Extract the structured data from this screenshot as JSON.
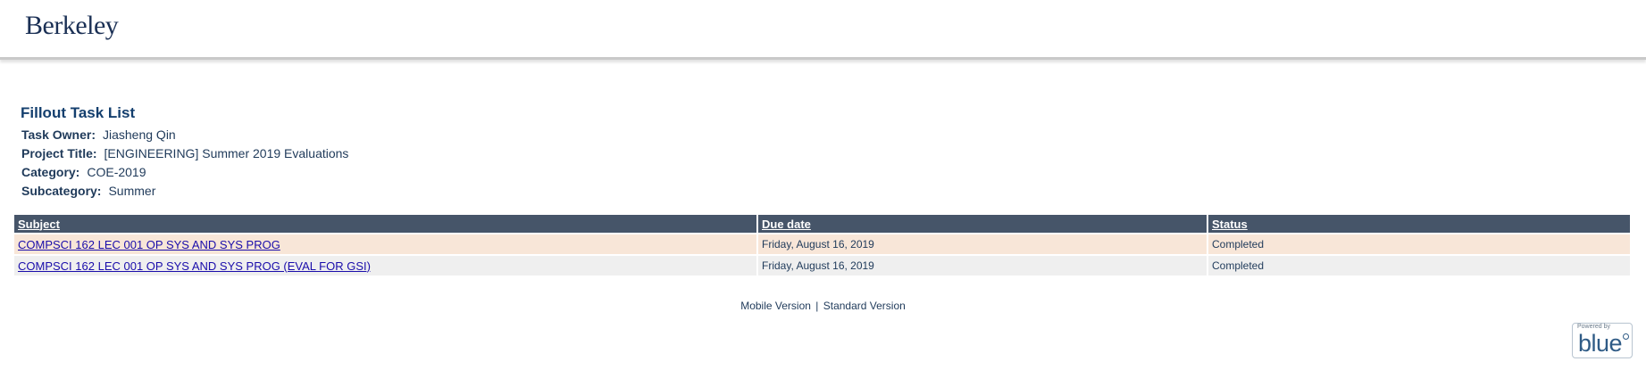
{
  "header": {
    "logo_text": "Berkeley"
  },
  "page": {
    "title": "Fillout Task List",
    "task_owner_label": "Task Owner:",
    "task_owner": "Jiasheng Qin",
    "project_title_label": "Project Title:",
    "project_title": "[ENGINEERING] Summer 2019 Evaluations",
    "category_label": "Category:",
    "category": "COE-2019",
    "subcategory_label": "Subcategory:",
    "subcategory": "Summer"
  },
  "table": {
    "columns": [
      "Subject",
      "Due date",
      "Status"
    ],
    "rows": [
      {
        "subject": "COMPSCI 162 LEC 001 OP SYS AND SYS PROG",
        "due": "Friday, August 16, 2019",
        "status": "Completed"
      },
      {
        "subject": "COMPSCI 162 LEC 001 OP SYS AND SYS PROG (EVAL FOR GSI)",
        "due": "Friday, August 16, 2019",
        "status": "Completed"
      }
    ]
  },
  "footer": {
    "mobile": "Mobile Version",
    "separator": "|",
    "standard": "Standard Version"
  },
  "badge": {
    "powered_by": "Powered by",
    "brand": "blue"
  }
}
